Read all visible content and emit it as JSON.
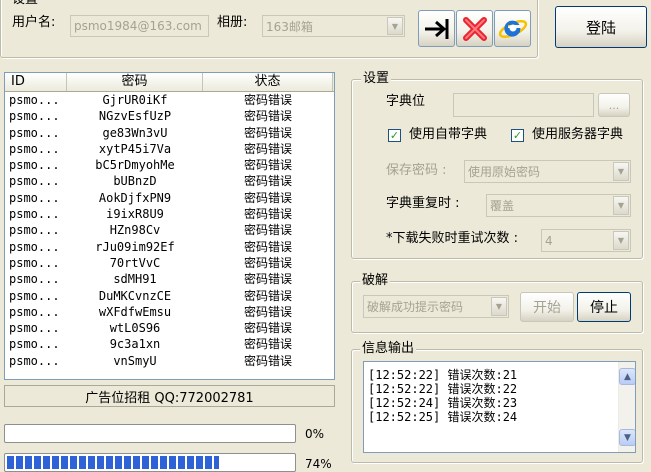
{
  "account": {
    "group_title": "设置",
    "username_label": "用户名:",
    "username_value": "psmo1984@163.com",
    "album_label": "相册:",
    "album_value": "163邮箱"
  },
  "login_button": "登陆",
  "table": {
    "columns": [
      "ID",
      "密码",
      "状态"
    ],
    "rows": [
      [
        "psmo...",
        "GjrUR0iKf",
        "密码错误"
      ],
      [
        "psmo...",
        "NGzvEsfUzP",
        "密码错误"
      ],
      [
        "psmo...",
        "ge83Wn3vU",
        "密码错误"
      ],
      [
        "psmo...",
        "xytP45i7Va",
        "密码错误"
      ],
      [
        "psmo...",
        "bC5rDmyohMe",
        "密码错误"
      ],
      [
        "psmo...",
        "bUBnzD",
        "密码错误"
      ],
      [
        "psmo...",
        "AokDjfxPN9",
        "密码错误"
      ],
      [
        "psmo...",
        "i9ixR8U9",
        "密码错误"
      ],
      [
        "psmo...",
        "HZn98Cv",
        "密码错误"
      ],
      [
        "psmo...",
        "rJu09im92Ef",
        "密码错误"
      ],
      [
        "psmo...",
        "70rtVvC",
        "密码错误"
      ],
      [
        "psmo...",
        "sdMH91",
        "密码错误"
      ],
      [
        "psmo...",
        "DuMKCvnzCE",
        "密码错误"
      ],
      [
        "psmo...",
        "wXFdfwEmsu",
        "密码错误"
      ],
      [
        "psmo...",
        "wtL0S96",
        "密码错误"
      ],
      [
        "psmo...",
        "9c3a1xn",
        "密码错误"
      ],
      [
        "psmo...",
        "vnSmyU",
        "密码错误"
      ]
    ]
  },
  "banner": "广告位招租  QQ:772002781",
  "progress": [
    {
      "value": 0,
      "label": "0%"
    },
    {
      "value": 74,
      "label": "74%"
    }
  ],
  "settings": {
    "title": "设置",
    "dict_label": "字典位",
    "browse_label": "...",
    "use_builtin_dict": "使用自带字典",
    "use_server_dict": "使用服务器字典",
    "save_pwd_label": "保存密码 :",
    "save_pwd_value": "使用原始密码",
    "dict_repeat_label": "字典重复时 :",
    "dict_repeat_value": "覆盖",
    "retry_label": "*下载失败时重试次数 :",
    "retry_value": "4"
  },
  "crack": {
    "title": "破解",
    "mode_value": "破解成功提示密码",
    "start_label": "开始",
    "stop_label": "停止"
  },
  "log": {
    "title": "信息输出",
    "lines": [
      "[12:52:22] 错误次数:21",
      "[12:52:22] 错误次数:22",
      "[12:52:24] 错误次数:23",
      "[12:52:25] 错误次数:24"
    ]
  },
  "colors": {
    "window_bg": "#ece9d8",
    "progress_fill": "#2e62d6",
    "red_x": "#e8242e",
    "ie_blue": "#1e73d8"
  }
}
